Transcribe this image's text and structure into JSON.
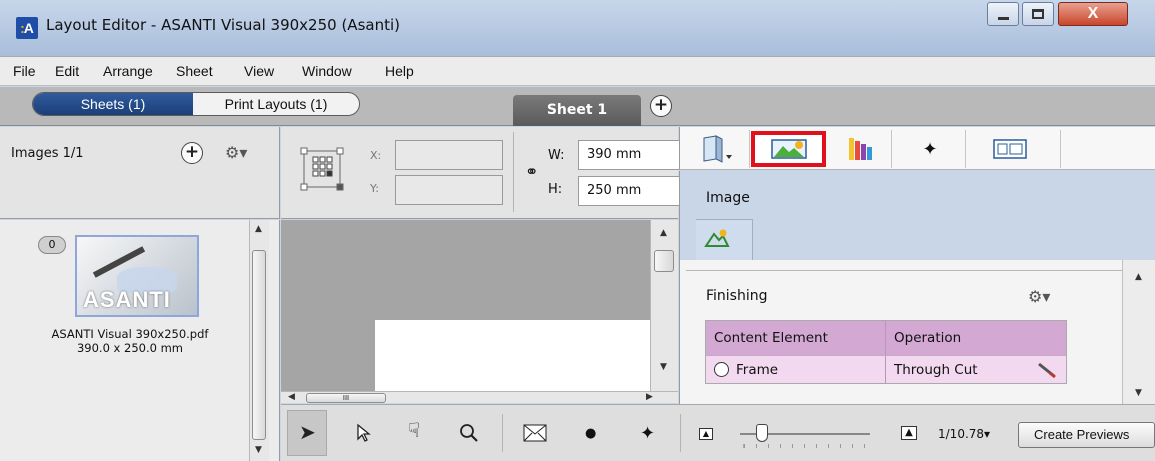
{
  "window": {
    "title": "Layout Editor - ASANTI Visual 390x250 (Asanti)",
    "icon_letter": "A",
    "close_glyph": "X"
  },
  "menu": [
    "File",
    "Edit",
    "Arrange",
    "Sheet",
    "View",
    "Window",
    "Help"
  ],
  "tabs": {
    "sheets_label": "Sheets (1)",
    "print_layouts_label": "Print Layouts (1)",
    "active_sheet": "Sheet 1",
    "add_glyph": "+"
  },
  "images_panel": {
    "title": "Images 1/1",
    "add_glyph": "+",
    "gear_glyph": "⚙▾",
    "item": {
      "badge": "0",
      "logo_text": "ASANTI",
      "file_name": "ASANTI Visual 390x250.pdf",
      "dimensions": "390.0 x 250.0 mm"
    }
  },
  "transform": {
    "x_label": "X:",
    "y_label": "Y:",
    "x_value": "",
    "y_value": "",
    "w_label": "W:",
    "h_label": "H:",
    "w_value": "390 mm",
    "h_value": "250 mm",
    "link_glyph": "⚭"
  },
  "right_panel": {
    "tab_icons": [
      "book-icon",
      "image-icon",
      "color-swatches-icon",
      "crosshair-icon",
      "id-card-icon"
    ],
    "selected_tab": 1,
    "subtitle": "Image",
    "section_title": "Finishing",
    "gear_glyph": "⚙▾",
    "table": {
      "headers": [
        "Content Element",
        "Operation"
      ],
      "rows": [
        {
          "element": "Frame",
          "operation": "Through Cut"
        }
      ]
    }
  },
  "toolbar": {
    "zoom_label": "1/10.78▾",
    "create_previews_label": "Create Previews",
    "scroll_glyph": "III"
  },
  "colors": {
    "selection_highlight": "#e0101d",
    "segment_active": "#1c3f78",
    "table_header": "#d3a8d3",
    "table_row": "#f3d9ef"
  }
}
